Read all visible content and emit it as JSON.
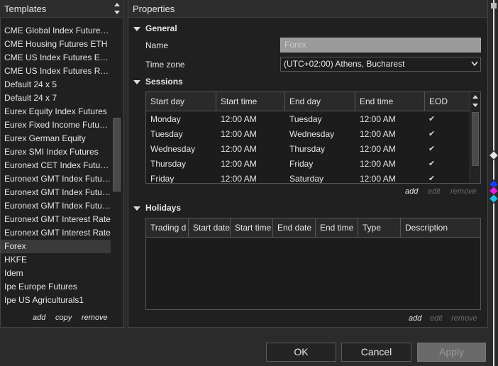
{
  "templates": {
    "title": "Templates",
    "items": [
      "CME Global Index Futures ETH",
      "CME Housing Futures ETH",
      "CME US Index Futures ETH",
      "CME US Index Futures RTH",
      "Default 24 x 5",
      "Default 24 x 7",
      "Eurex Equity Index Futures",
      "Eurex Fixed Income Futures",
      "Eurex German Equity",
      "Eurex SMI Index Futures",
      "Euronext CET Index Futures",
      "Euronext GMT Index Futures",
      "Euronext GMT Index Futures",
      "Euronext GMT Index Futures",
      "Euronext GMT Interest Rate",
      "Euronext GMT Interest Rate",
      "Forex",
      "HKFE",
      "Idem",
      "Ipe Europe Futures",
      "Ipe US Agriculturals1"
    ],
    "selected_index": 16,
    "actions": {
      "add": "add",
      "copy": "copy",
      "remove": "remove"
    }
  },
  "properties": {
    "title": "Properties",
    "general": {
      "label": "General",
      "name_label": "Name",
      "name_value": "Forex",
      "timezone_label": "Time zone",
      "timezone_value": "(UTC+02:00) Athens, Bucharest"
    },
    "sessions": {
      "label": "Sessions",
      "columns": [
        "Start day",
        "Start time",
        "End day",
        "End time",
        "EOD"
      ],
      "rows": [
        {
          "start_day": "Monday",
          "start_time": "12:00 AM",
          "end_day": "Tuesday",
          "end_time": "12:00 AM",
          "eod": "✔"
        },
        {
          "start_day": "Tuesday",
          "start_time": "12:00 AM",
          "end_day": "Wednesday",
          "end_time": "12:00 AM",
          "eod": "✔"
        },
        {
          "start_day": "Wednesday",
          "start_time": "12:00 AM",
          "end_day": "Thursday",
          "end_time": "12:00 AM",
          "eod": "✔"
        },
        {
          "start_day": "Thursday",
          "start_time": "12:00 AM",
          "end_day": "Friday",
          "end_time": "12:00 AM",
          "eod": "✔"
        },
        {
          "start_day": "Friday",
          "start_time": "12:00 AM",
          "end_day": "Saturday",
          "end_time": "12:00 AM",
          "eod": "✔"
        }
      ],
      "actions": {
        "add": "add",
        "edit": "edit",
        "remove": "remove"
      }
    },
    "holidays": {
      "label": "Holidays",
      "columns": [
        "Trading d",
        "Start date",
        "Start time",
        "End date",
        "End time",
        "Type",
        "Description"
      ],
      "actions": {
        "add": "add",
        "edit": "edit",
        "remove": "remove"
      }
    }
  },
  "buttons": {
    "ok": "OK",
    "cancel": "Cancel",
    "apply": "Apply"
  },
  "colors": {
    "marker_blue": "#1e3cff",
    "marker_magenta": "#e020e0",
    "marker_cyan": "#20c0e0"
  }
}
